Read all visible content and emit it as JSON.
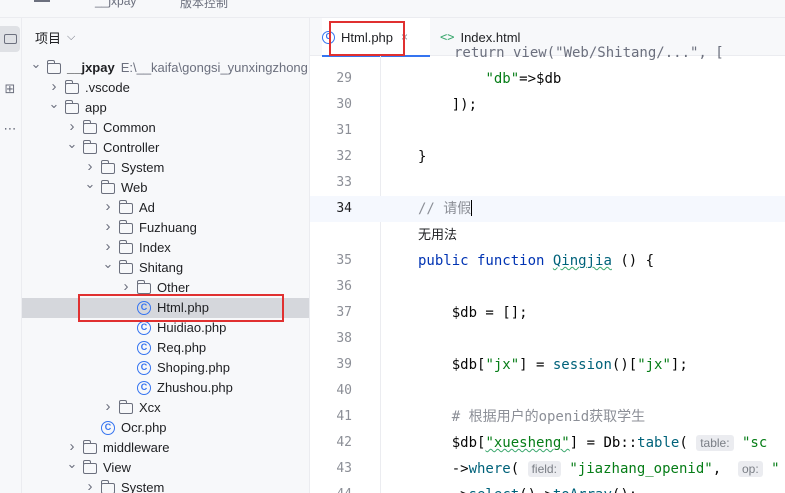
{
  "titlebar": {
    "text1": "__jxpay",
    "text2": "版本控制"
  },
  "panel": {
    "title": "项目"
  },
  "tree": [
    {
      "label": "__jxpay",
      "path": "E:\\__kaifa\\gongsi_yunxingzhong",
      "kind": "folder",
      "open": true,
      "depth": 0,
      "bold": true
    },
    {
      "label": ".vscode",
      "kind": "folder",
      "open": false,
      "depth": 1
    },
    {
      "label": "app",
      "kind": "folder",
      "open": true,
      "depth": 1
    },
    {
      "label": "Common",
      "kind": "folder",
      "open": false,
      "depth": 2
    },
    {
      "label": "Controller",
      "kind": "folder",
      "open": true,
      "depth": 2
    },
    {
      "label": "System",
      "kind": "folder",
      "open": false,
      "depth": 3
    },
    {
      "label": "Web",
      "kind": "folder",
      "open": true,
      "depth": 3
    },
    {
      "label": "Ad",
      "kind": "folder",
      "open": false,
      "depth": 4
    },
    {
      "label": "Fuzhuang",
      "kind": "folder",
      "open": false,
      "depth": 4
    },
    {
      "label": "Index",
      "kind": "folder",
      "open": false,
      "depth": 4
    },
    {
      "label": "Shitang",
      "kind": "folder",
      "open": true,
      "depth": 4
    },
    {
      "label": "Other",
      "kind": "folder",
      "open": false,
      "depth": 5
    },
    {
      "label": "Html.php",
      "kind": "class",
      "depth": 5,
      "selected": true
    },
    {
      "label": "Huidiao.php",
      "kind": "class",
      "depth": 5
    },
    {
      "label": "Req.php",
      "kind": "class",
      "depth": 5
    },
    {
      "label": "Shoping.php",
      "kind": "class",
      "depth": 5
    },
    {
      "label": "Zhushou.php",
      "kind": "class",
      "depth": 5
    },
    {
      "label": "Xcx",
      "kind": "folder",
      "open": false,
      "depth": 4
    },
    {
      "label": "Ocr.php",
      "kind": "class",
      "depth": 3
    },
    {
      "label": "middleware",
      "kind": "folder",
      "open": false,
      "depth": 2
    },
    {
      "label": "View",
      "kind": "folder",
      "open": true,
      "depth": 2
    },
    {
      "label": "System",
      "kind": "folder",
      "open": false,
      "depth": 3
    }
  ],
  "tabs": [
    {
      "label": "Html.php",
      "active": true,
      "icon": "php-class-icon"
    },
    {
      "label": "Index.html",
      "active": false,
      "icon": "html-icon"
    }
  ],
  "code": {
    "top_partial": "return view(\"Web/Shitang/...\", [",
    "lines": [
      {
        "num": "29",
        "html": "        <span class=\"str\">\"db\"</span>=>$db"
      },
      {
        "num": "30",
        "html": "    ]);"
      },
      {
        "num": "31",
        "html": ""
      },
      {
        "num": "32",
        "html": "}"
      },
      {
        "num": "33",
        "html": ""
      },
      {
        "num": "34",
        "html": "<span class=\"cm\">// 请假</span><span class=\"cursor\"></span>",
        "current": true
      },
      {
        "num": "",
        "hint": "无用法"
      },
      {
        "num": "35",
        "html": "<span class=\"kw\">public function</span> <span class=\"fn squig\">Qingjia</span> () {"
      },
      {
        "num": "36",
        "html": ""
      },
      {
        "num": "37",
        "html": "    $db = [];"
      },
      {
        "num": "38",
        "html": ""
      },
      {
        "num": "39",
        "html": "    $db[<span class=\"str\">\"jx\"</span>] = <span class=\"fn\">session</span>()[<span class=\"str\">\"jx\"</span>];"
      },
      {
        "num": "40",
        "html": ""
      },
      {
        "num": "41",
        "html": "    <span class=\"cm\"># 根据用户的openid获取学生</span>"
      },
      {
        "num": "42",
        "html": "    $db[<span class=\"str squig\">\"xuesheng\"</span>] = <span class=\"cls\">Db</span>::<span class=\"fn\">table</span>( <span class=\"pname\">table:</span> <span class=\"str\">\"sc</span>"
      },
      {
        "num": "43",
        "html": "    -><span class=\"fn\">where</span>( <span class=\"pname\">field:</span> <span class=\"str\">\"jiazhang_openid\"</span>,  <span class=\"pname\">op:</span> <span class=\"str\">\"</span>"
      },
      {
        "num": "44",
        "html": "    -><span class=\"fn\">select</span>()-><span class=\"fn\">toArray</span>();"
      }
    ]
  }
}
